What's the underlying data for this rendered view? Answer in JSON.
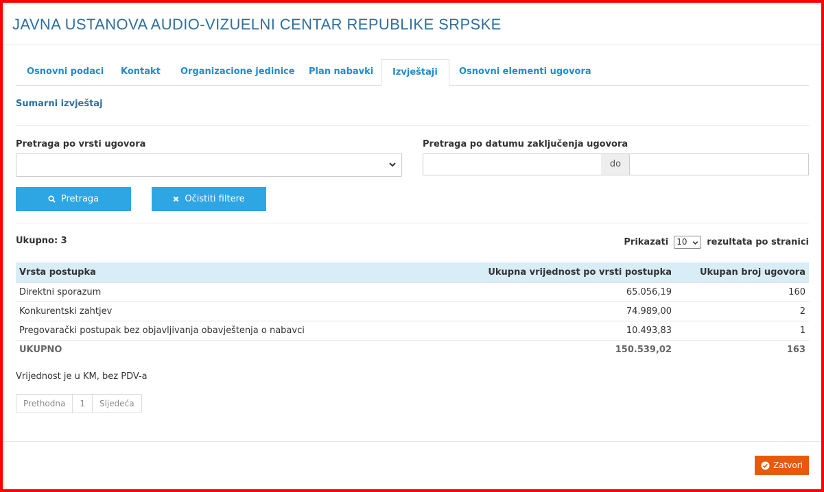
{
  "header": {
    "title": "JAVNA USTANOVA AUDIO-VIZUELNI CENTAR REPUBLIKE SRPSKE"
  },
  "tabs": [
    {
      "label": "Osnovni podaci",
      "active": false
    },
    {
      "label": "Kontakt",
      "active": false
    },
    {
      "label": "Organizacione jedinice",
      "active": false
    },
    {
      "label": "Plan nabavki",
      "active": false
    },
    {
      "label": "Izvještaji",
      "active": true
    },
    {
      "label": "Osnovni elementi ugovora",
      "active": false
    }
  ],
  "report": {
    "subtitle": "Sumarni izvještaj"
  },
  "filters": {
    "contract_type_label": "Pretraga po vrsti ugovora",
    "contract_type_value": "",
    "date_label": "Pretraga po datumu zaključenja ugovora",
    "date_from": "",
    "date_separator": "do",
    "date_to": ""
  },
  "buttons": {
    "search_label": "Pretraga",
    "clear_label": "Očistiti filtere",
    "close_label": "Zatvori"
  },
  "results": {
    "total_label": "Ukupno: 3",
    "show_label": "Prikazati",
    "per_page": "10",
    "per_page_suffix": "rezultata po stranici"
  },
  "table": {
    "headers": [
      "Vrsta postupka",
      "Ukupna vrijednost po vrsti postupka",
      "Ukupan broj ugovora"
    ],
    "rows": [
      [
        "Direktni sporazum",
        "65.056,19",
        "160"
      ],
      [
        "Konkurentski zahtjev",
        "74.989,00",
        "2"
      ],
      [
        "Pregovarački postupak bez objavljivanja obavještenja o nabavci",
        "10.493,83",
        "1"
      ]
    ],
    "total": [
      "UKUPNO",
      "150.539,02",
      "163"
    ]
  },
  "note": "Vrijednost je u KM, bez PDV-a",
  "pagination": {
    "prev": "Prethodna",
    "page": "1",
    "next": "Sljedeća"
  },
  "colors": {
    "accent": "#2ea6e4",
    "title": "#2f6f9f",
    "link": "#1f8ccf",
    "close": "#e8590c",
    "table_header": "#d9edf7",
    "frame": "#ff0000"
  },
  "icons": {
    "search": "search-icon",
    "clear": "times-icon",
    "close": "check-circle-icon",
    "select": "chevron-down-icon"
  }
}
